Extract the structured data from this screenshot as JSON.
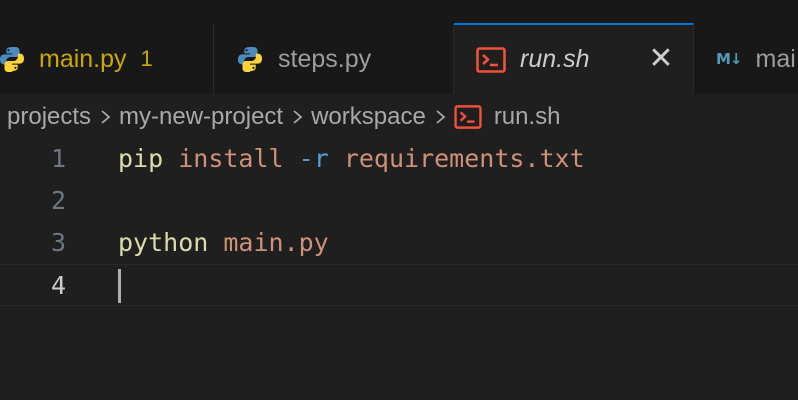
{
  "tabs": [
    {
      "label": "main.py",
      "badge": "1",
      "icon": "python-icon",
      "state": "modified"
    },
    {
      "label": "steps.py",
      "icon": "python-icon",
      "state": "normal"
    },
    {
      "label": "run.sh",
      "icon": "terminal-icon",
      "state": "active"
    },
    {
      "label": "mai",
      "icon": "markdown-icon",
      "state": "normal"
    }
  ],
  "markdown_icon_text": "M↓",
  "breadcrumb": {
    "items": [
      "projects",
      "my-new-project",
      "workspace",
      "run.sh"
    ],
    "file_icon": "terminal-icon"
  },
  "editor": {
    "lines": [
      {
        "number": "1",
        "tokens": [
          {
            "text": "pip",
            "kind": "cmd"
          },
          {
            "text": " "
          },
          {
            "text": "install",
            "kind": "arg"
          },
          {
            "text": " "
          },
          {
            "text": "-r",
            "kind": "flag"
          },
          {
            "text": " "
          },
          {
            "text": "requirements.txt",
            "kind": "arg"
          }
        ]
      },
      {
        "number": "2",
        "tokens": []
      },
      {
        "number": "3",
        "tokens": [
          {
            "text": "python",
            "kind": "cmd"
          },
          {
            "text": " "
          },
          {
            "text": "main.py",
            "kind": "arg"
          }
        ]
      },
      {
        "number": "4",
        "tokens": [],
        "current": true
      }
    ]
  },
  "colors": {
    "accent": "#0078d4",
    "modified": "#cca700",
    "shell_icon": "#f05138",
    "python_blue": "#3572a5",
    "python_yellow": "#ffd43b"
  }
}
